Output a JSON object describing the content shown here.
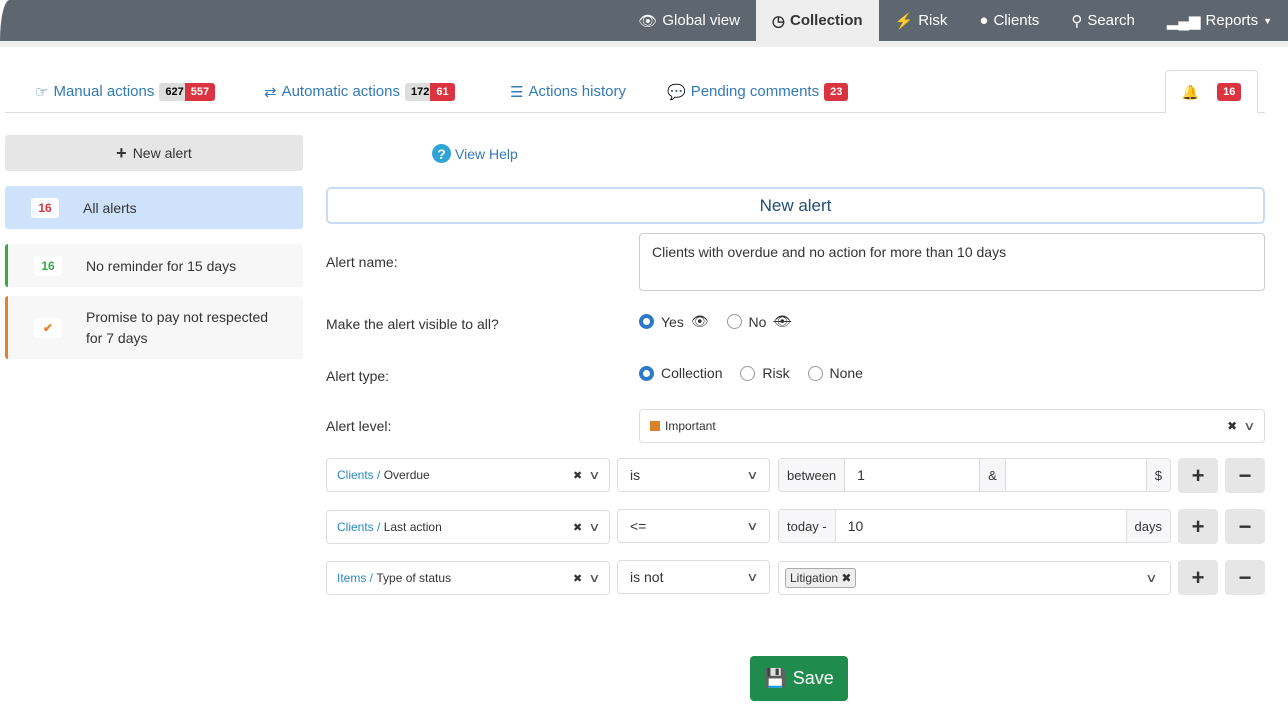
{
  "nav": {
    "items": [
      {
        "label": "Global view",
        "icon": "eye-icon"
      },
      {
        "label": "Collection",
        "icon": "clock-icon",
        "active": true
      },
      {
        "label": "Risk",
        "icon": "bolt-icon"
      },
      {
        "label": "Clients",
        "icon": "globe-icon"
      },
      {
        "label": "Search",
        "icon": "search-icon"
      },
      {
        "label": "Reports",
        "icon": "bar-chart-icon"
      }
    ]
  },
  "tabs": {
    "manual": {
      "label": "Manual actions",
      "count1": "627",
      "count2": "557"
    },
    "automatic": {
      "label": "Automatic actions",
      "count1": "172",
      "count2": "61"
    },
    "history": {
      "label": "Actions history"
    },
    "comments": {
      "label": "Pending comments",
      "count": "23"
    },
    "alerts": {
      "count": "16"
    }
  },
  "sidebar": {
    "new_alert": "New alert",
    "items": [
      {
        "badge": "16",
        "label": "All alerts"
      },
      {
        "badge": "16",
        "label": "No reminder for 15 days"
      },
      {
        "badge": "✔",
        "label": "Promise to pay not respected for 7 days"
      }
    ]
  },
  "help": "View Help",
  "form": {
    "title": "New alert",
    "name_label": "Alert name:",
    "name_value": "Clients with overdue and no action for more than 10 days",
    "visible_label": "Make the alert visible to all?",
    "visible_yes": "Yes",
    "visible_no": "No",
    "type_label": "Alert type:",
    "type_options": [
      "Collection",
      "Risk",
      "None"
    ],
    "level_label": "Alert level:",
    "level_value": "Important",
    "level_color": "#d9822b",
    "conditions": [
      {
        "entity": "Clients",
        "field": "Overdue",
        "op": "is",
        "prefix": "between",
        "value1": "1",
        "sep": "&",
        "value2": "",
        "suffix": "$"
      },
      {
        "entity": "Clients",
        "field": "Last action",
        "op": "<=",
        "prefix": "today -",
        "value1": "10",
        "suffix": "days"
      },
      {
        "entity": "Items",
        "field": "Type of status",
        "op": "is not",
        "tag": "Litigation"
      }
    ]
  },
  "save": "Save"
}
